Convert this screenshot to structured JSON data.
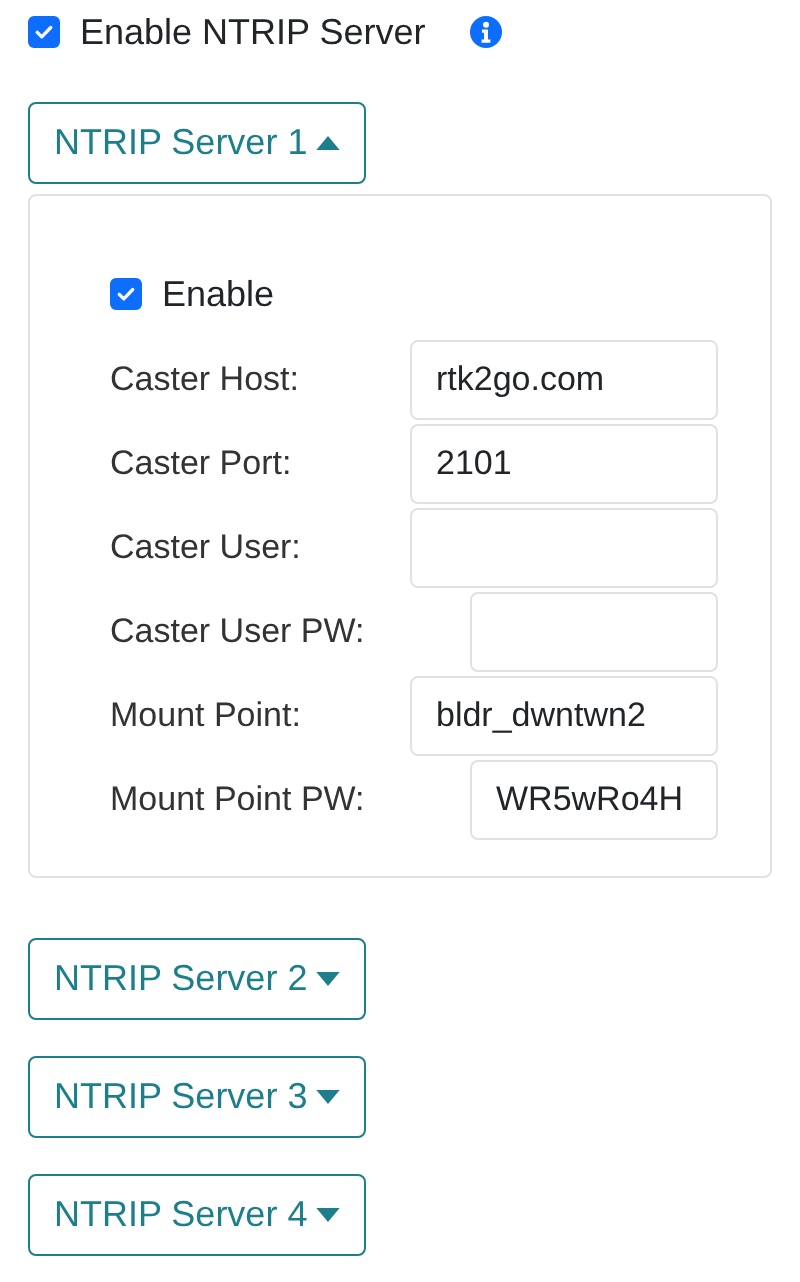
{
  "enable_server": {
    "label": "Enable NTRIP Server",
    "checked": true
  },
  "servers": [
    {
      "label": "NTRIP Server 1",
      "expanded": true,
      "enable": {
        "label": "Enable",
        "checked": true
      },
      "fields": [
        {
          "label": "Caster Host:",
          "value": "rtk2go.com",
          "kind": "text"
        },
        {
          "label": "Caster Port:",
          "value": "2101",
          "kind": "text"
        },
        {
          "label": "Caster User:",
          "kind": "text"
        },
        {
          "label": "Caster User PW:",
          "kind": "password"
        },
        {
          "label": "Mount Point:",
          "value": "bldr_dwntwn2",
          "kind": "text"
        },
        {
          "label": "Mount Point PW:",
          "value": "WR5wRo4H",
          "kind": "password"
        }
      ]
    },
    {
      "label": "NTRIP Server 2",
      "expanded": false
    },
    {
      "label": "NTRIP Server 3",
      "expanded": false
    },
    {
      "label": "NTRIP Server 4",
      "expanded": false
    }
  ]
}
